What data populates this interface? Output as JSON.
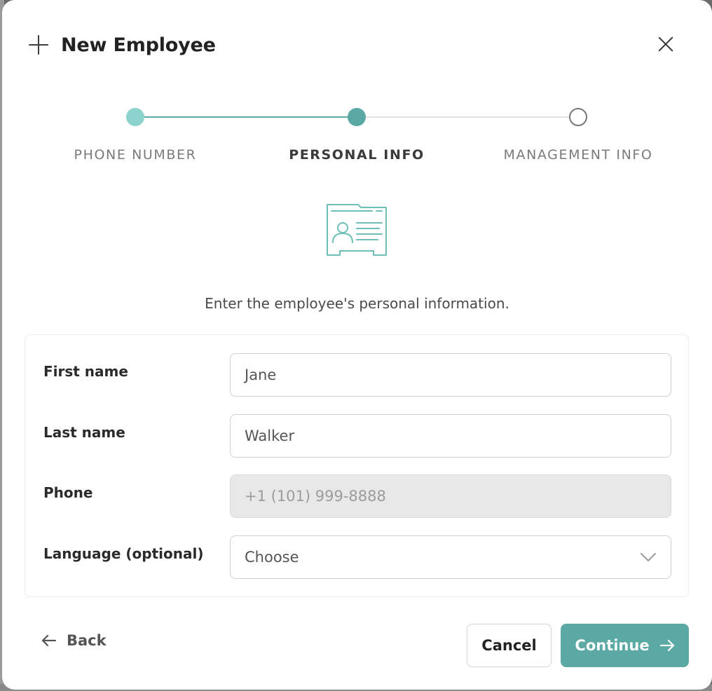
{
  "dialog": {
    "title": "New Employee",
    "icons": {
      "leading": "plus-icon",
      "close": "close-icon"
    }
  },
  "stepper": {
    "steps": [
      {
        "label": "PHONE NUMBER",
        "state": "completed"
      },
      {
        "label": "PERSONAL INFO",
        "state": "current"
      },
      {
        "label": "MANAGEMENT INFO",
        "state": "pending"
      }
    ]
  },
  "illustration": {
    "icon": "id-card-icon"
  },
  "intro_text": "Enter the employee's personal information.",
  "form": {
    "first_name": {
      "label": "First name",
      "value": "Jane"
    },
    "last_name": {
      "label": "Last name",
      "value": "Walker"
    },
    "phone": {
      "label": "Phone",
      "value": "+1 (101) 999-8888",
      "disabled": true
    },
    "language": {
      "label": "Language (optional)",
      "value": "Choose",
      "icon": "chevron-down-icon"
    }
  },
  "footer": {
    "back_label": "Back",
    "cancel_label": "Cancel",
    "continue_label": "Continue"
  },
  "colors": {
    "accent": "#5aa9a4",
    "accent_light": "#8dd3cd",
    "disabled_field": "#e8e8e8"
  }
}
